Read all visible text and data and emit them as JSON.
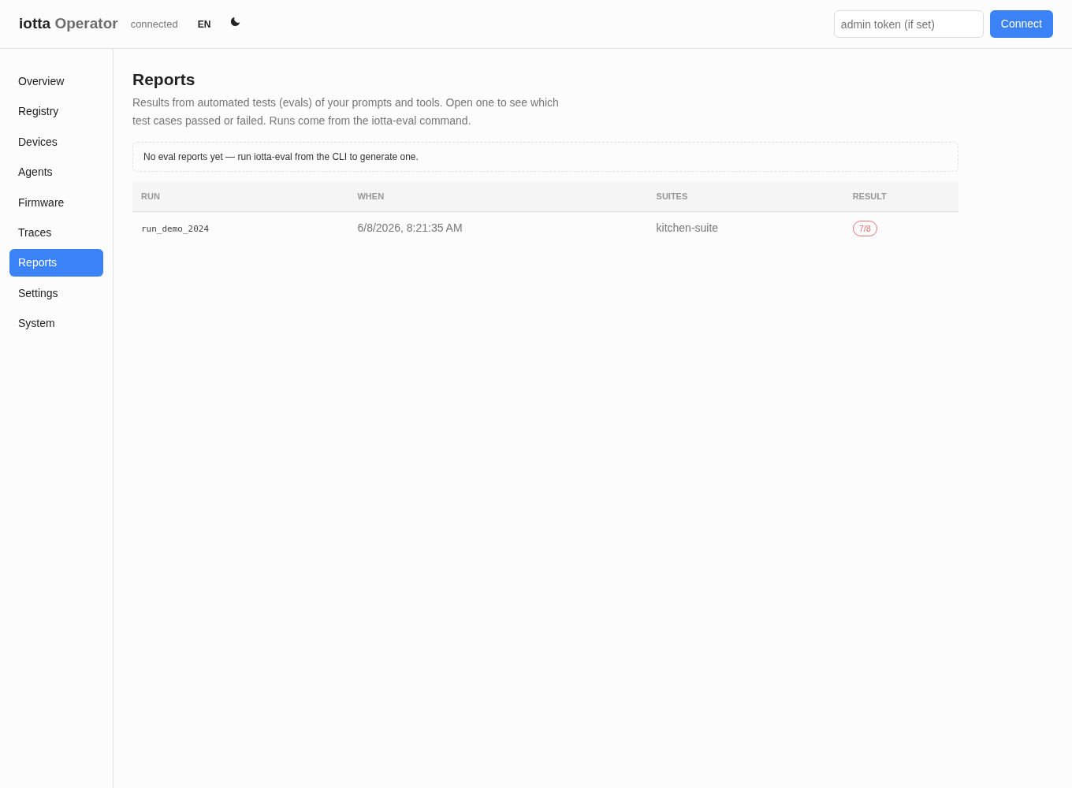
{
  "header": {
    "brand_strong": "iotta",
    "brand_light": "Operator",
    "status": "connected",
    "language": "EN",
    "token": {
      "placeholder": "admin token (if set)"
    },
    "connect_button": "Connect"
  },
  "sidebar": {
    "items": [
      {
        "label": "Overview",
        "selected": false
      },
      {
        "label": "Registry",
        "selected": false
      },
      {
        "label": "Devices",
        "selected": false
      },
      {
        "label": "Agents",
        "selected": false
      },
      {
        "label": "Firmware",
        "selected": false
      },
      {
        "label": "Traces",
        "selected": false
      },
      {
        "label": "Reports",
        "selected": true
      },
      {
        "label": "Settings",
        "selected": false
      },
      {
        "label": "System",
        "selected": false
      }
    ]
  },
  "page": {
    "title": "Reports",
    "description": "Results from automated tests (evals) of your prompts and tools. Open one to see which test cases passed or failed. Runs come from the iotta-eval command.",
    "notice": "No eval reports yet — run iotta-eval from the CLI to generate one."
  },
  "table": {
    "columns": [
      "RUN",
      "WHEN",
      "SUITES",
      "RESULT"
    ],
    "rows": [
      {
        "run": "run_demo_2024",
        "when": "6/8/2026, 8:21:35 AM",
        "suites": "kitchen-suite",
        "result": "7/8",
        "color": "#e57373"
      }
    ]
  }
}
